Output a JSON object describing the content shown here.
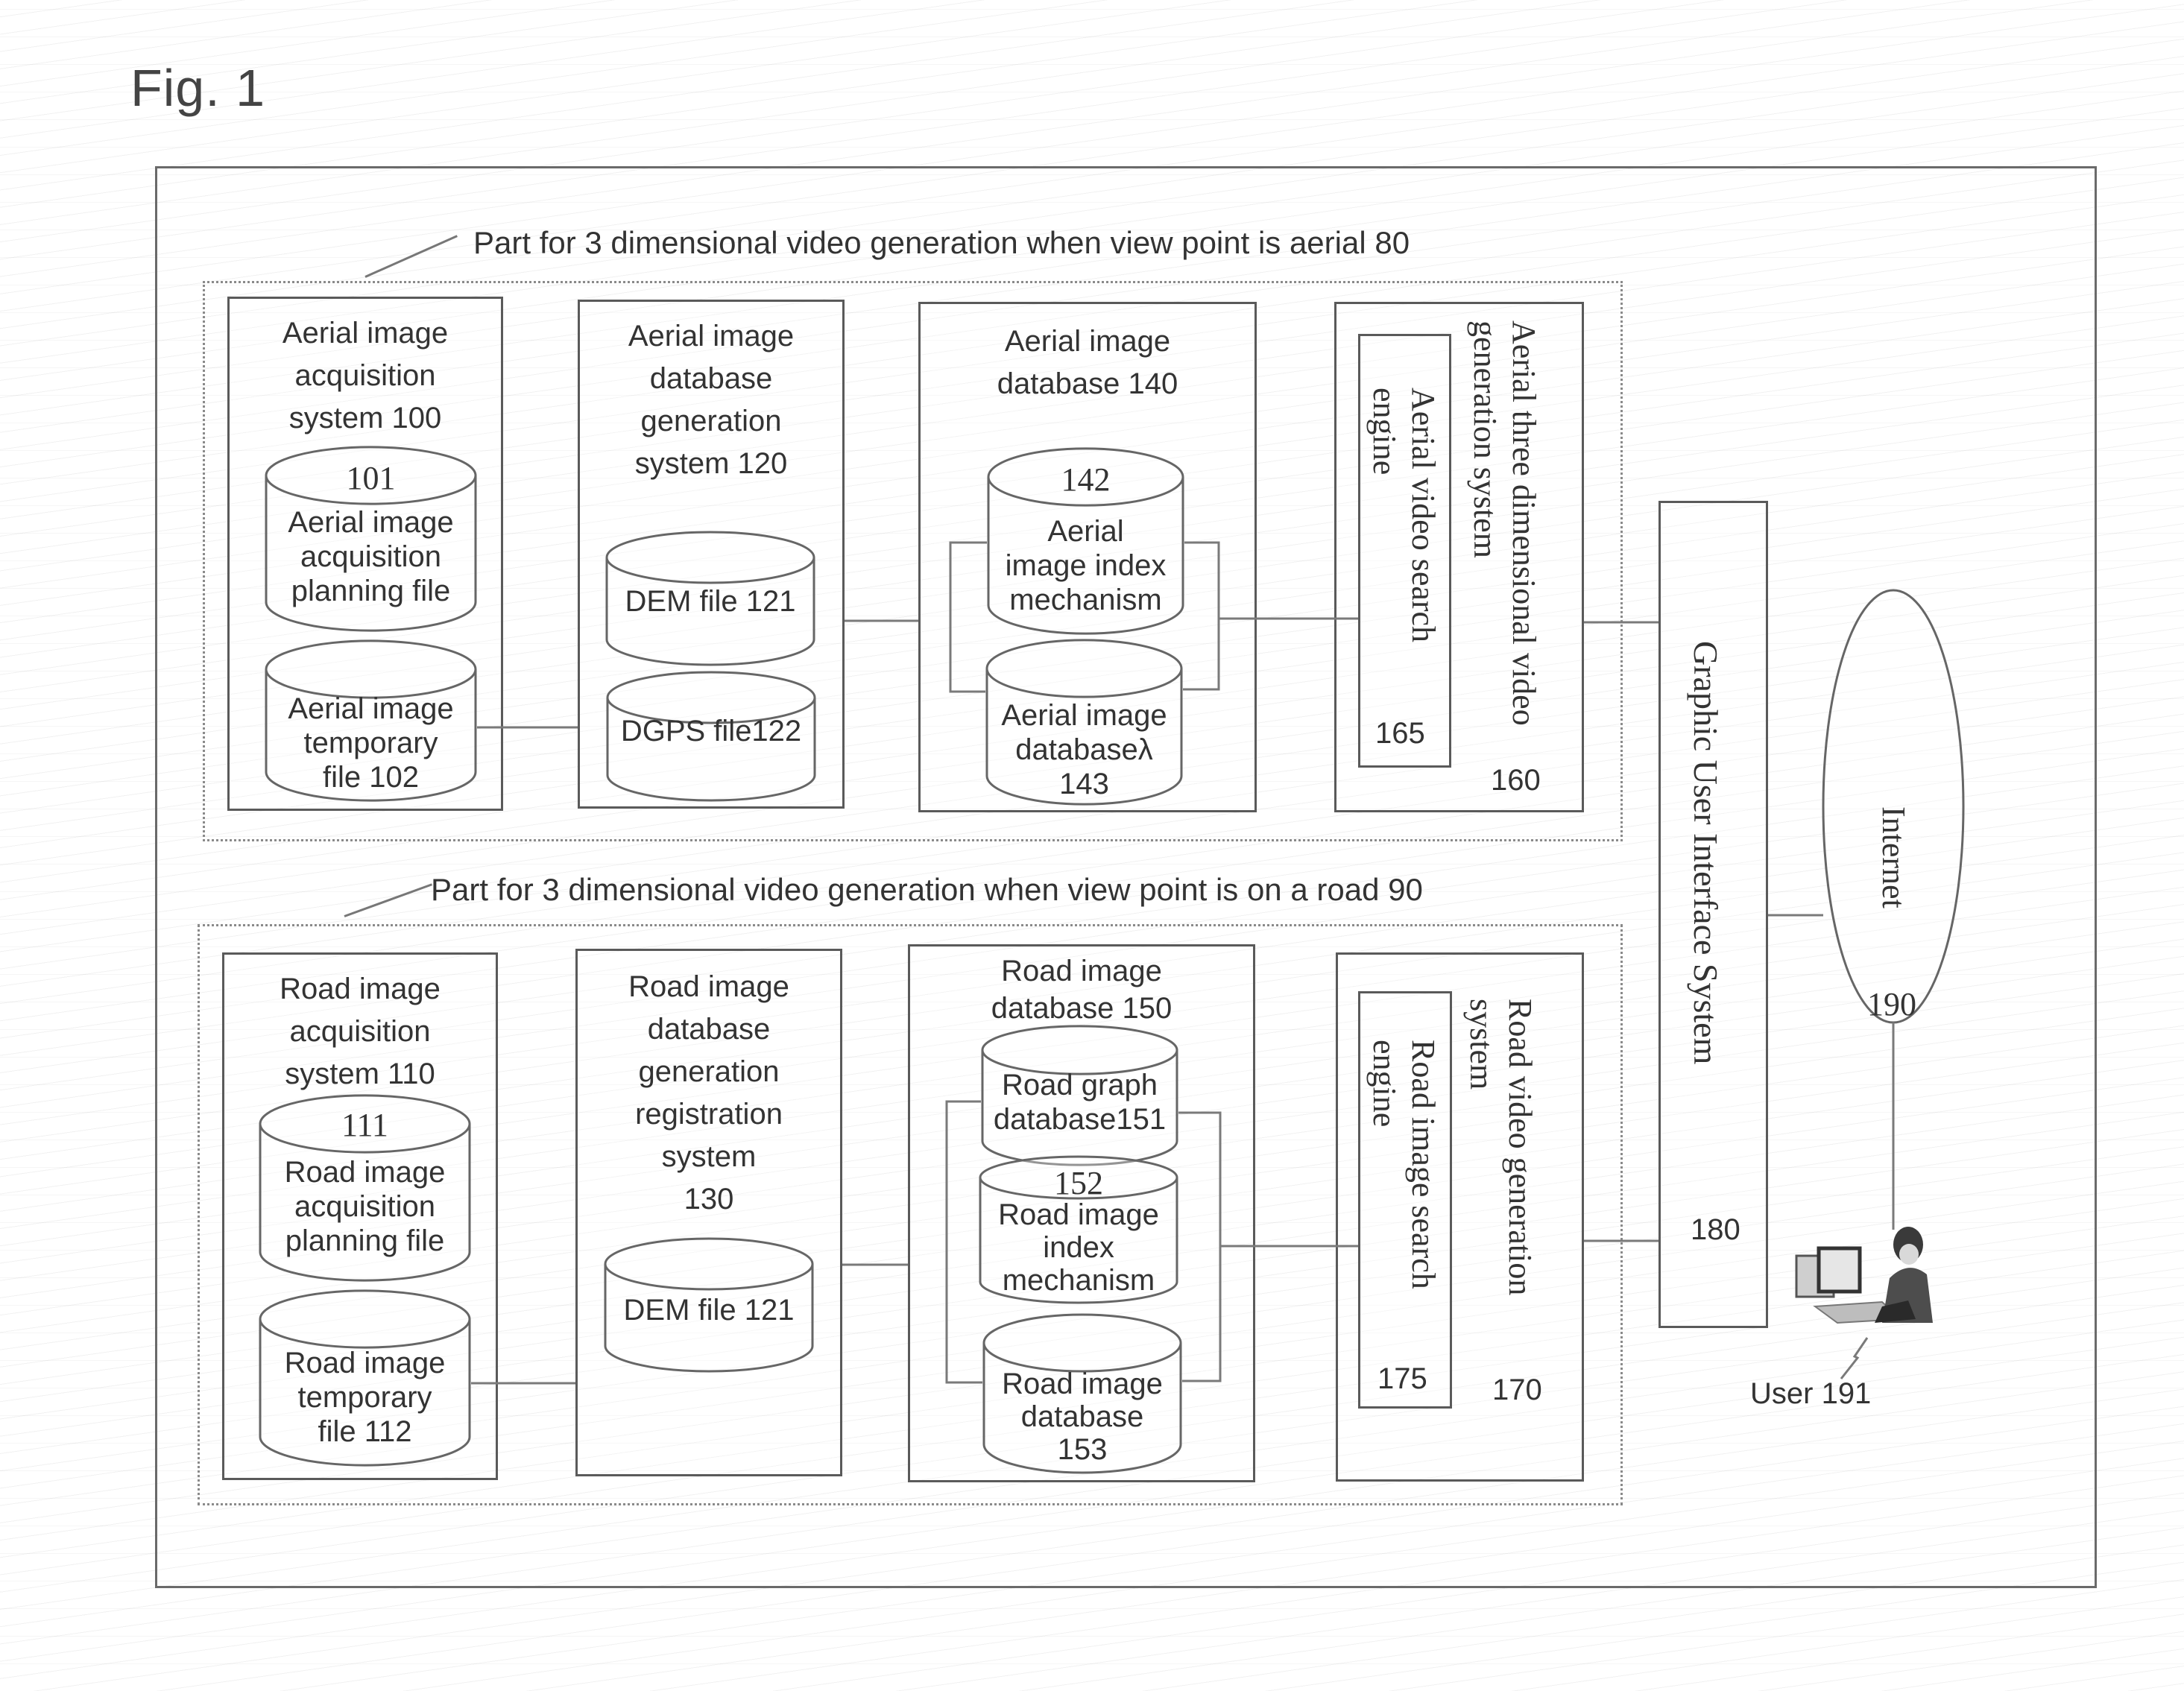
{
  "figure": {
    "title": "Fig. 1"
  },
  "aerial_group": {
    "title": "Part for 3 dimensional video generation when view point is aerial 80",
    "acquisition_system": {
      "title_lines": [
        "Aerial image",
        "acquisition",
        "system 100"
      ],
      "planning_file": {
        "number": "101",
        "lines": [
          "Aerial image",
          "acquisition",
          "planning file"
        ]
      },
      "temporary_file": {
        "lines": [
          "Aerial image",
          "temporary",
          "file 102"
        ]
      }
    },
    "db_generation_system": {
      "title_lines": [
        "Aerial image",
        "database",
        "generation",
        "system 120"
      ],
      "dem_file": {
        "lines": [
          "DEM file 121"
        ]
      },
      "dgps_file": {
        "lines": [
          "DGPS file122"
        ]
      }
    },
    "image_database": {
      "title_lines": [
        "Aerial image",
        "database 140"
      ],
      "index_mechanism": {
        "number": "142",
        "lines": [
          "Aerial",
          "image index",
          "mechanism"
        ]
      },
      "database_store": {
        "lines": [
          "Aerial image",
          "databaseλ",
          "143"
        ]
      }
    },
    "video_generation_system": {
      "title": "Aerial three dimensional video generation system",
      "number": "160",
      "search_engine": {
        "title": "Aerial video search engine",
        "number": "165"
      }
    }
  },
  "road_group": {
    "title": "Part for 3 dimensional video generation when view point is on a road 90",
    "acquisition_system": {
      "title_lines": [
        "Road image",
        "acquisition",
        "system 110"
      ],
      "planning_file": {
        "number": "111",
        "lines": [
          "Road image",
          "acquisition",
          "planning file"
        ]
      },
      "temporary_file": {
        "lines": [
          "Road image",
          "temporary",
          "file 112"
        ]
      }
    },
    "db_generation_system": {
      "title_lines": [
        "Road image",
        "database",
        "generation",
        "registration",
        "system",
        "130"
      ],
      "dem_file": {
        "lines": [
          "DEM file 121"
        ]
      }
    },
    "image_database": {
      "title_lines": [
        "Road image",
        "database 150"
      ],
      "graph_database": {
        "lines": [
          "Road graph",
          "database151"
        ]
      },
      "index_mechanism": {
        "number": "152",
        "lines": [
          "Road image",
          "index",
          "mechanism"
        ]
      },
      "database_store": {
        "lines": [
          "Road image",
          "database",
          "153"
        ]
      }
    },
    "video_generation_system": {
      "title": "Road video generation system",
      "number": "170",
      "search_engine": {
        "title": "Road image search engine",
        "number": "175"
      }
    }
  },
  "gui_system": {
    "title": "Graphic User Interface System",
    "number": "180"
  },
  "internet": {
    "title": "Internet",
    "number": "190"
  },
  "user": {
    "label": "User 191"
  }
}
